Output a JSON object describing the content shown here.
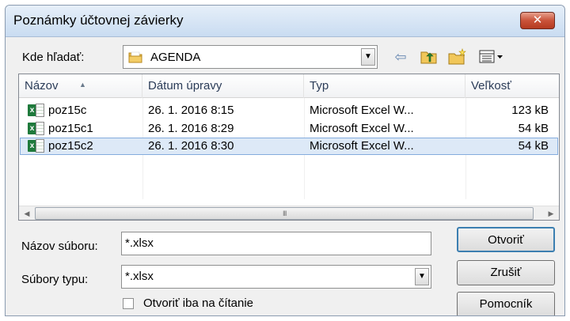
{
  "window": {
    "title": "Poznámky účtovnej závierky",
    "close_symbol": "✕"
  },
  "lookin": {
    "label": "Kde hľadať:",
    "value": "AGENDA",
    "arrow": "▼"
  },
  "toolbar": {
    "back_symbol": "⇦",
    "up_symbol": "⤴",
    "newfolder_symbol": "✱",
    "views_symbol": "▦▾"
  },
  "columns": {
    "name": "Názov",
    "date": "Dátum úpravy",
    "type": "Typ",
    "size": "Veľkosť",
    "sort_arrow": "▲"
  },
  "files": [
    {
      "name": "poz15c",
      "date": "26. 1. 2016 8:15",
      "type": "Microsoft Excel W...",
      "size": "123 kB"
    },
    {
      "name": "poz15c1",
      "date": "26. 1. 2016 8:29",
      "type": "Microsoft Excel W...",
      "size": "54 kB"
    },
    {
      "name": "poz15c2",
      "date": "26. 1. 2016 8:30",
      "type": "Microsoft Excel W...",
      "size": "54 kB"
    }
  ],
  "file_icon_glyph": "x",
  "scrollbar": {
    "left": "◀",
    "right": "▶",
    "grip": "III"
  },
  "filename": {
    "label": "Názov súboru:",
    "value": "*.xlsx"
  },
  "filetype": {
    "label": "Súbory typu:",
    "value": "*.xlsx",
    "arrow": "▼"
  },
  "buttons": {
    "open": "Otvoriť",
    "cancel": "Zrušiť",
    "help": "Pomocník"
  },
  "readonly": {
    "label": "Otvoriť iba na čítanie"
  }
}
